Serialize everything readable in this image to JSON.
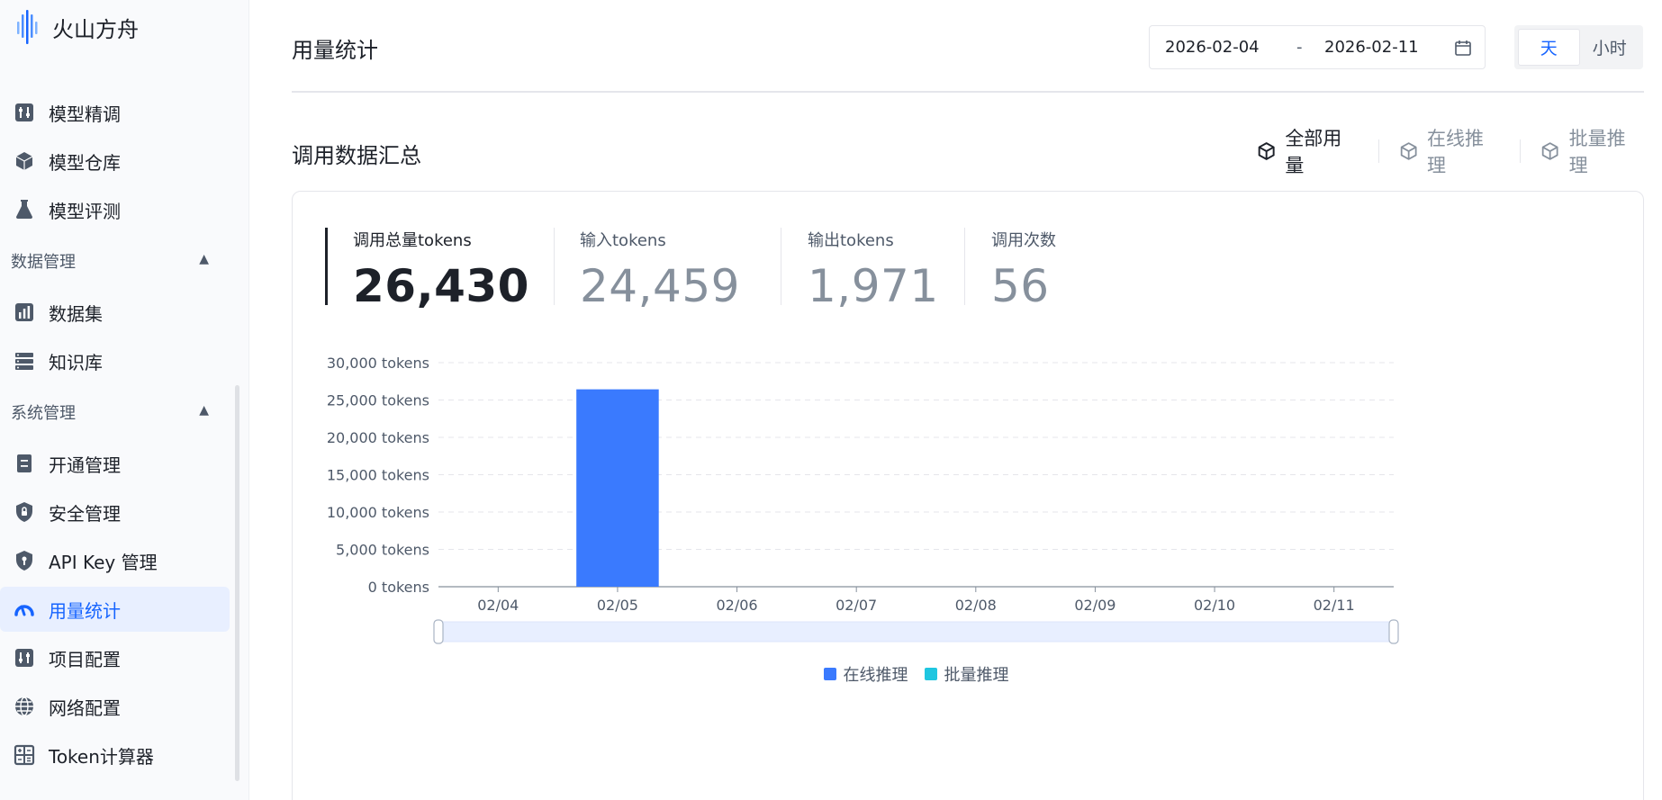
{
  "app": {
    "name": "火山方舟"
  },
  "sidebar": {
    "items": [
      {
        "label": "模型精调"
      },
      {
        "label": "模型仓库"
      },
      {
        "label": "模型评测"
      }
    ],
    "groups": [
      {
        "label": "数据管理",
        "items": [
          {
            "label": "数据集"
          },
          {
            "label": "知识库"
          }
        ]
      },
      {
        "label": "系统管理",
        "items": [
          {
            "label": "开通管理"
          },
          {
            "label": "安全管理"
          },
          {
            "label": "API Key 管理"
          },
          {
            "label": "用量统计"
          },
          {
            "label": "项目配置"
          },
          {
            "label": "网络配置"
          },
          {
            "label": "Token计算器"
          }
        ]
      }
    ],
    "active": "用量统计"
  },
  "header": {
    "title": "用量统计",
    "date_start": "2026-02-04",
    "date_sep": "-",
    "date_end": "2026-02-11",
    "granularity": [
      {
        "label": "天",
        "selected": true
      },
      {
        "label": "小时",
        "selected": false
      }
    ]
  },
  "section": {
    "title": "调用数据汇总",
    "filters": [
      {
        "label": "全部用量",
        "selected": true
      },
      {
        "label": "在线推理",
        "selected": false
      },
      {
        "label": "批量推理",
        "selected": false
      }
    ]
  },
  "metrics": [
    {
      "label": "调用总量tokens",
      "value": "26,430"
    },
    {
      "label": "输入tokens",
      "value": "24,459"
    },
    {
      "label": "输出tokens",
      "value": "1,971"
    },
    {
      "label": "调用次数",
      "value": "56"
    }
  ],
  "colors": {
    "accent": "#1664ff",
    "online": "#3a7afe",
    "batch": "#1fc6e0"
  },
  "chart_data": {
    "type": "bar",
    "categories": [
      "02/04",
      "02/05",
      "02/06",
      "02/07",
      "02/08",
      "02/09",
      "02/10",
      "02/11"
    ],
    "series": [
      {
        "name": "在线推理",
        "values": [
          0,
          26430,
          0,
          0,
          0,
          0,
          0,
          0
        ]
      },
      {
        "name": "批量推理",
        "values": [
          0,
          0,
          0,
          0,
          0,
          0,
          0,
          0
        ]
      }
    ],
    "yticks": [
      "30,000 tokens",
      "25,000 tokens",
      "20,000 tokens",
      "15,000 tokens",
      "10,000 tokens",
      "5,000 tokens",
      "0 tokens"
    ],
    "ylim": [
      0,
      30000
    ],
    "grid": true,
    "legend": "bottom-center",
    "xlabel": "",
    "ylabel": ""
  }
}
